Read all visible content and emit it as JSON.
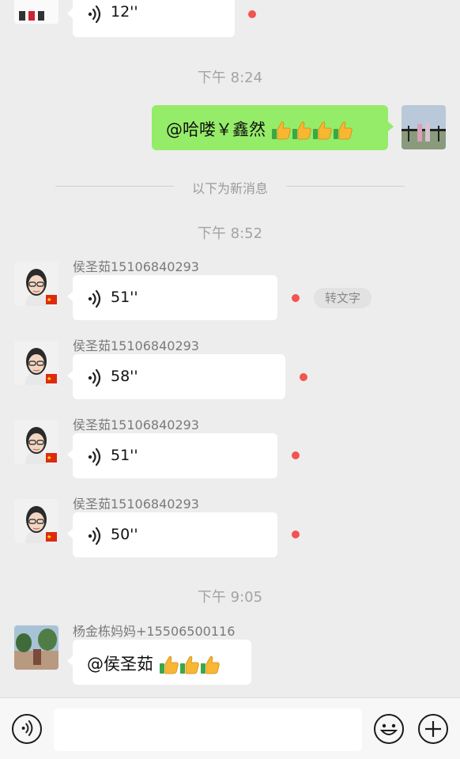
{
  "top_voice": {
    "duration": "12''"
  },
  "times": [
    "下午 8:24",
    "下午 8:52",
    "下午 9:05"
  ],
  "self_message": {
    "text": "@哈喽￥鑫然"
  },
  "new_messages_divider": "以下为新消息",
  "voice_messages": [
    {
      "sender": "侯圣茹15106840293",
      "duration": "51''"
    },
    {
      "sender": "侯圣茹15106840293",
      "duration": "58''"
    },
    {
      "sender": "侯圣茹15106840293",
      "duration": "51''"
    },
    {
      "sender": "侯圣茹15106840293",
      "duration": "50''"
    }
  ],
  "to_text_label": "转文字",
  "last_message": {
    "sender": "杨金栋妈妈+15506500116",
    "text": "@侯圣茹"
  },
  "icons": {
    "voice_toggle": "voice-mode-icon",
    "emoji": "emoji-icon",
    "plus": "plus-icon",
    "thumbs_up": "thumbs-up-icon"
  },
  "colors": {
    "self_bubble": "#95ec69",
    "unread_dot": "#f25450",
    "background": "#ededed"
  }
}
